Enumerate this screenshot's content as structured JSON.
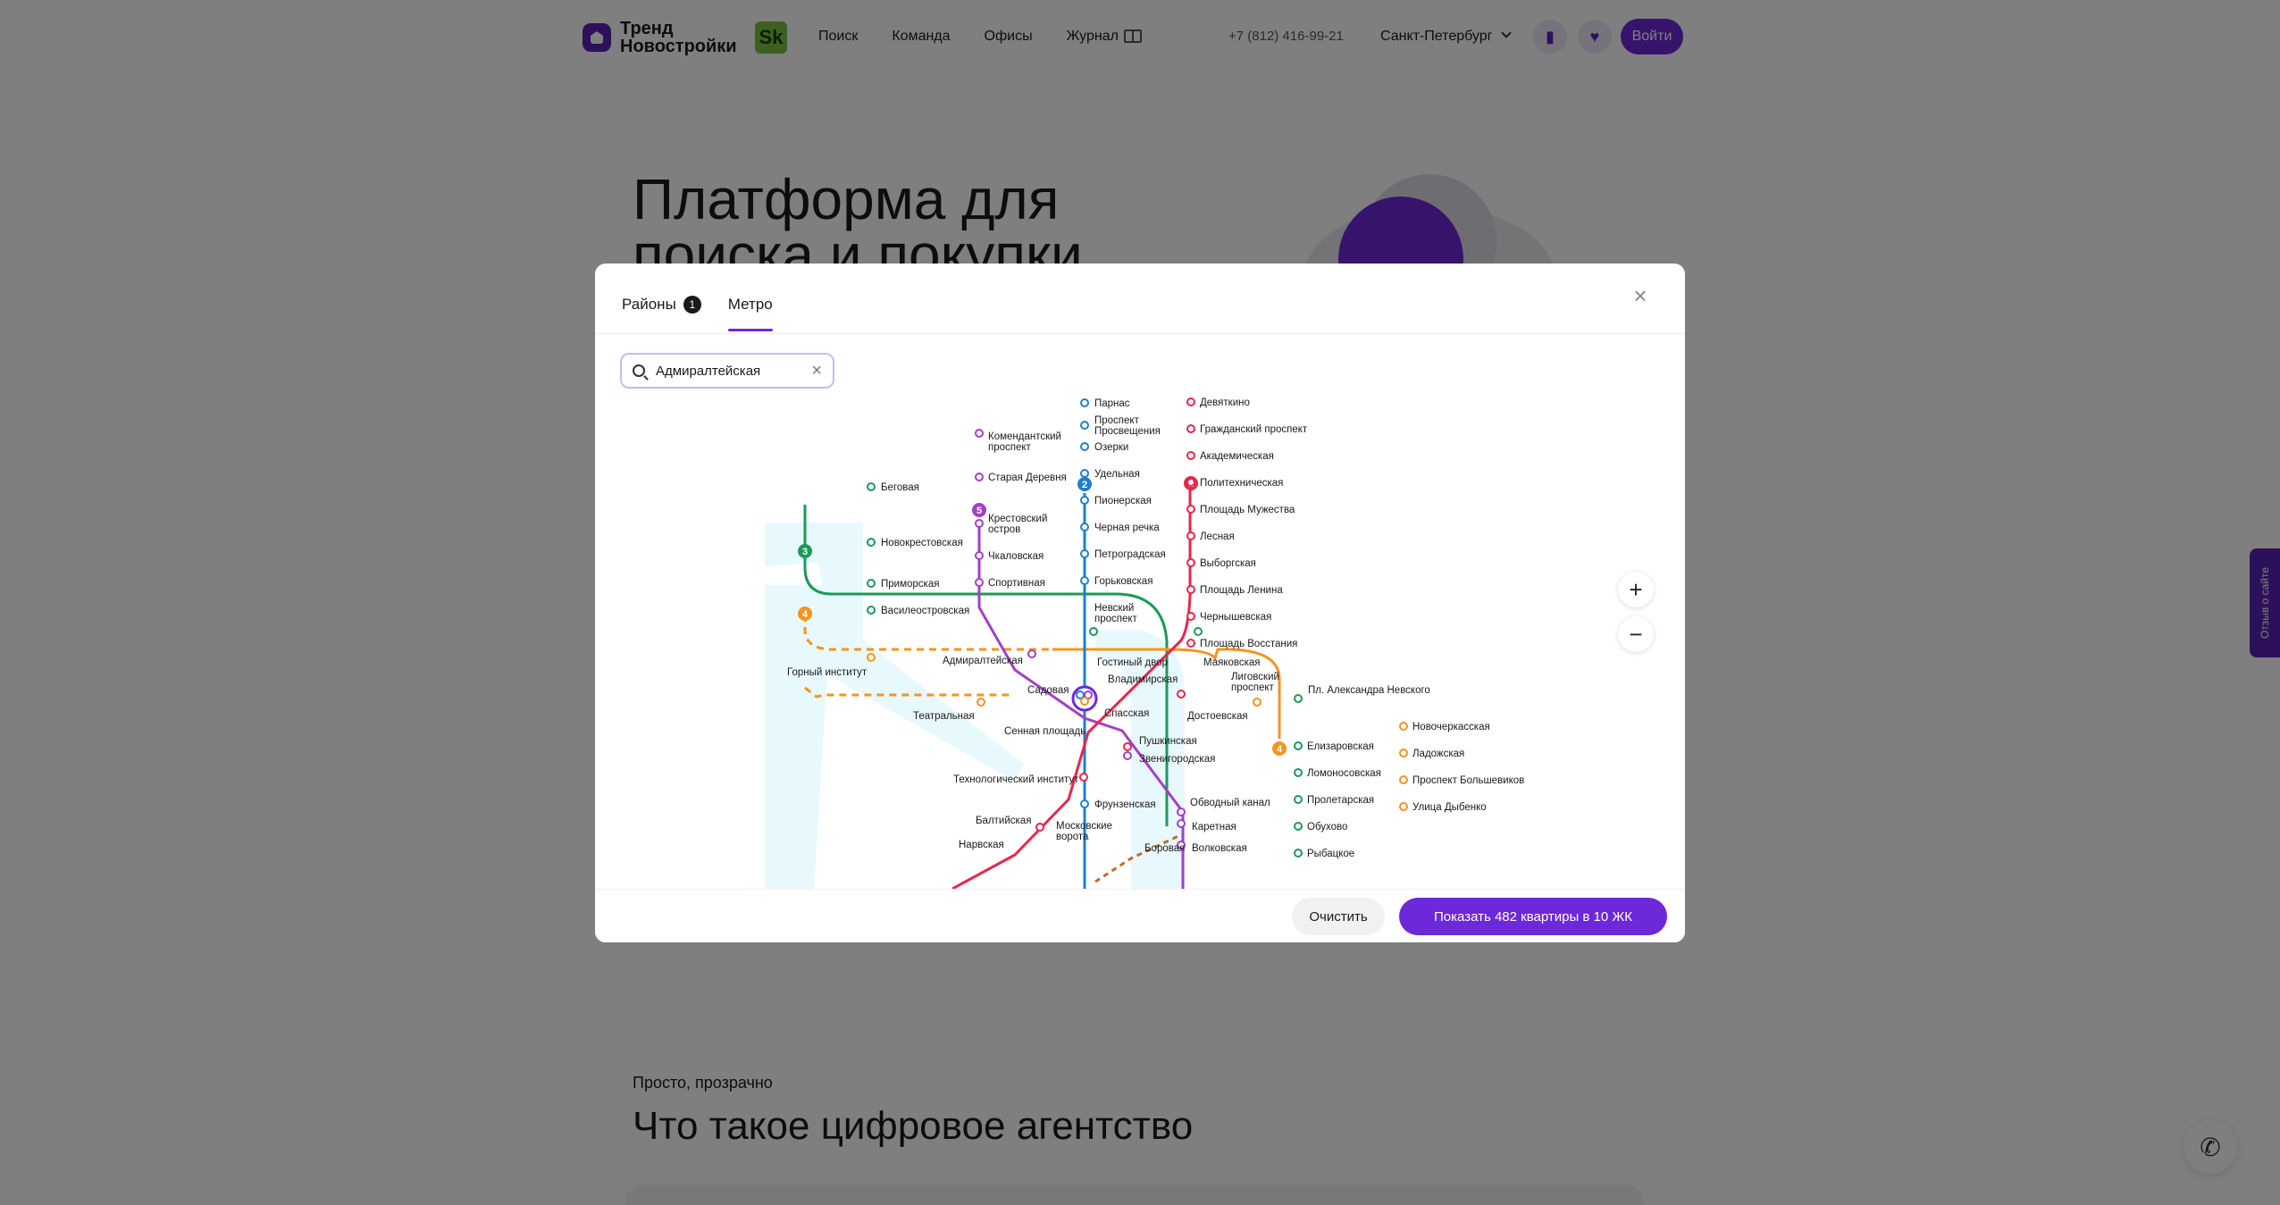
{
  "header": {
    "logo_text": "Тренд Новостройки",
    "sk_badge": "Sk",
    "nav": [
      "Поиск",
      "Команда",
      "Офисы",
      "Журнал"
    ],
    "phone": "+7 (812) 416-99-21",
    "city": "Санкт-Петербург",
    "login": "Войти"
  },
  "hero": {
    "title": "Платформа для поиска и покупки"
  },
  "section": {
    "eyebrow": "Просто, прозрачно",
    "title": "Что такое цифровое агентство"
  },
  "feedback_tab": "Отзыв о сайте",
  "modal": {
    "tabs": [
      {
        "label": "Районы",
        "badge": "1"
      },
      {
        "label": "Метро"
      }
    ],
    "search": {
      "value": "Адмиралтейская"
    },
    "clear_button": "Очистить",
    "show_button": "Показать 482 квартиры в 10 ЖК"
  },
  "metro": {
    "colors": {
      "line1": "#e8264b",
      "line2": "#1e7fd0",
      "line3": "#1a9a5a",
      "line4": "#f5941e",
      "line5": "#a33fc6",
      "accent": "#6d28d9"
    },
    "line_numbers": [
      "1",
      "2",
      "3",
      "4",
      "5"
    ],
    "stations": [
      "Парнас",
      "Проспект",
      "Просвещения",
      "Озерки",
      "Удельная",
      "Пионерская",
      "Черная речка",
      "Петроградская",
      "Горьковская",
      "Невский",
      "проспект",
      "Девяткино",
      "Гражданский проспект",
      "Академическая",
      "Политехническая",
      "Площадь Мужества",
      "Лесная",
      "Выборгская",
      "Площадь Ленина",
      "Чернышевская",
      "Площадь Восстания",
      "Комендантский",
      "проспект",
      "Старая Деревня",
      "Крестовский",
      "остров",
      "Чкаловская",
      "Спортивная",
      "Беговая",
      "Новокрестовская",
      "Приморская",
      "Василеостровская",
      "Гостиный двор",
      "Маяковская",
      "Адмиралтейская",
      "Горный институт",
      "Садовая",
      "Владимирская",
      "Лиговский",
      "проспект",
      "Пл. Александра Невского",
      "Театральная",
      "Спасская",
      "Достоевская",
      "Сенная площадь",
      "Пушкинская",
      "Звенигородская",
      "Новочеркасская",
      "Ладожская",
      "Проспект Большевиков",
      "Улица Дыбенко",
      "Елизаровская",
      "Ломоносовская",
      "Пролетарская",
      "Обухово",
      "Рыбацкое",
      "Технологический институт",
      "Фрунзенская",
      "Обводный канал",
      "Балтийская",
      "Московские",
      "ворота",
      "Каретная",
      "Нарвская",
      "Боровая",
      "Волковская"
    ]
  }
}
